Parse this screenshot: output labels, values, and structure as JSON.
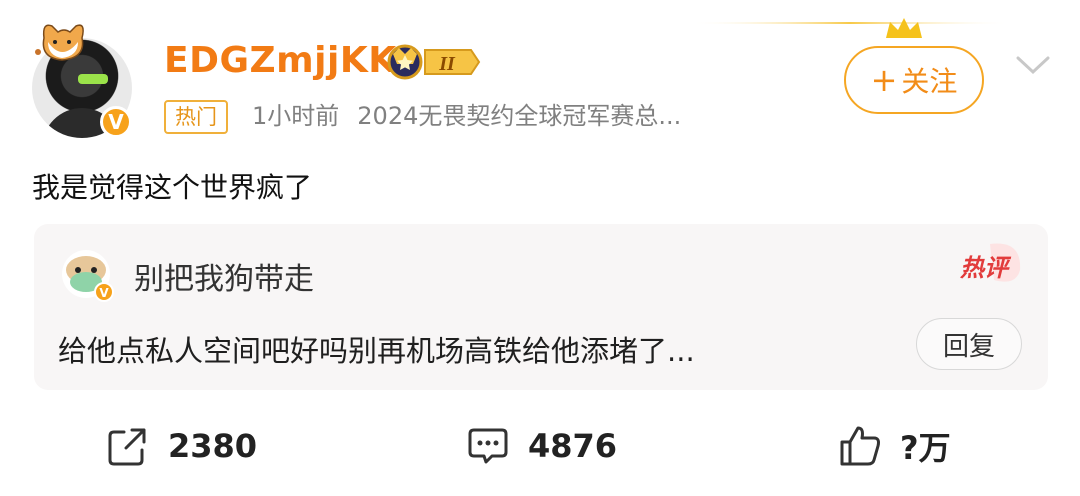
{
  "post": {
    "username": "EDGZmjjKK",
    "vip_level": "II",
    "hot_tag": "热门",
    "time": "1小时前",
    "source": "2024无畏契约全球冠军赛总...",
    "follow_label": "关注",
    "text": "我是觉得这个世界疯了"
  },
  "hot_comment": {
    "name": "别把我狗带走",
    "badge": "热评",
    "text": "给他点私人空间吧好吗别再机场高铁给他添堵了...",
    "reply_label": "回复"
  },
  "actions": {
    "share_count": "2380",
    "comment_count": "4876",
    "like_count": "?万"
  },
  "colors": {
    "accent": "#f27b14",
    "verify": "#f7a21b",
    "hot_badge": "#e23b3b",
    "card_bg": "#f8f6f6"
  },
  "icons": [
    "pet-sticker-icon",
    "verified-icon",
    "vip-crown-icon",
    "chevron-down-icon",
    "share-icon",
    "comment-icon",
    "like-icon"
  ]
}
